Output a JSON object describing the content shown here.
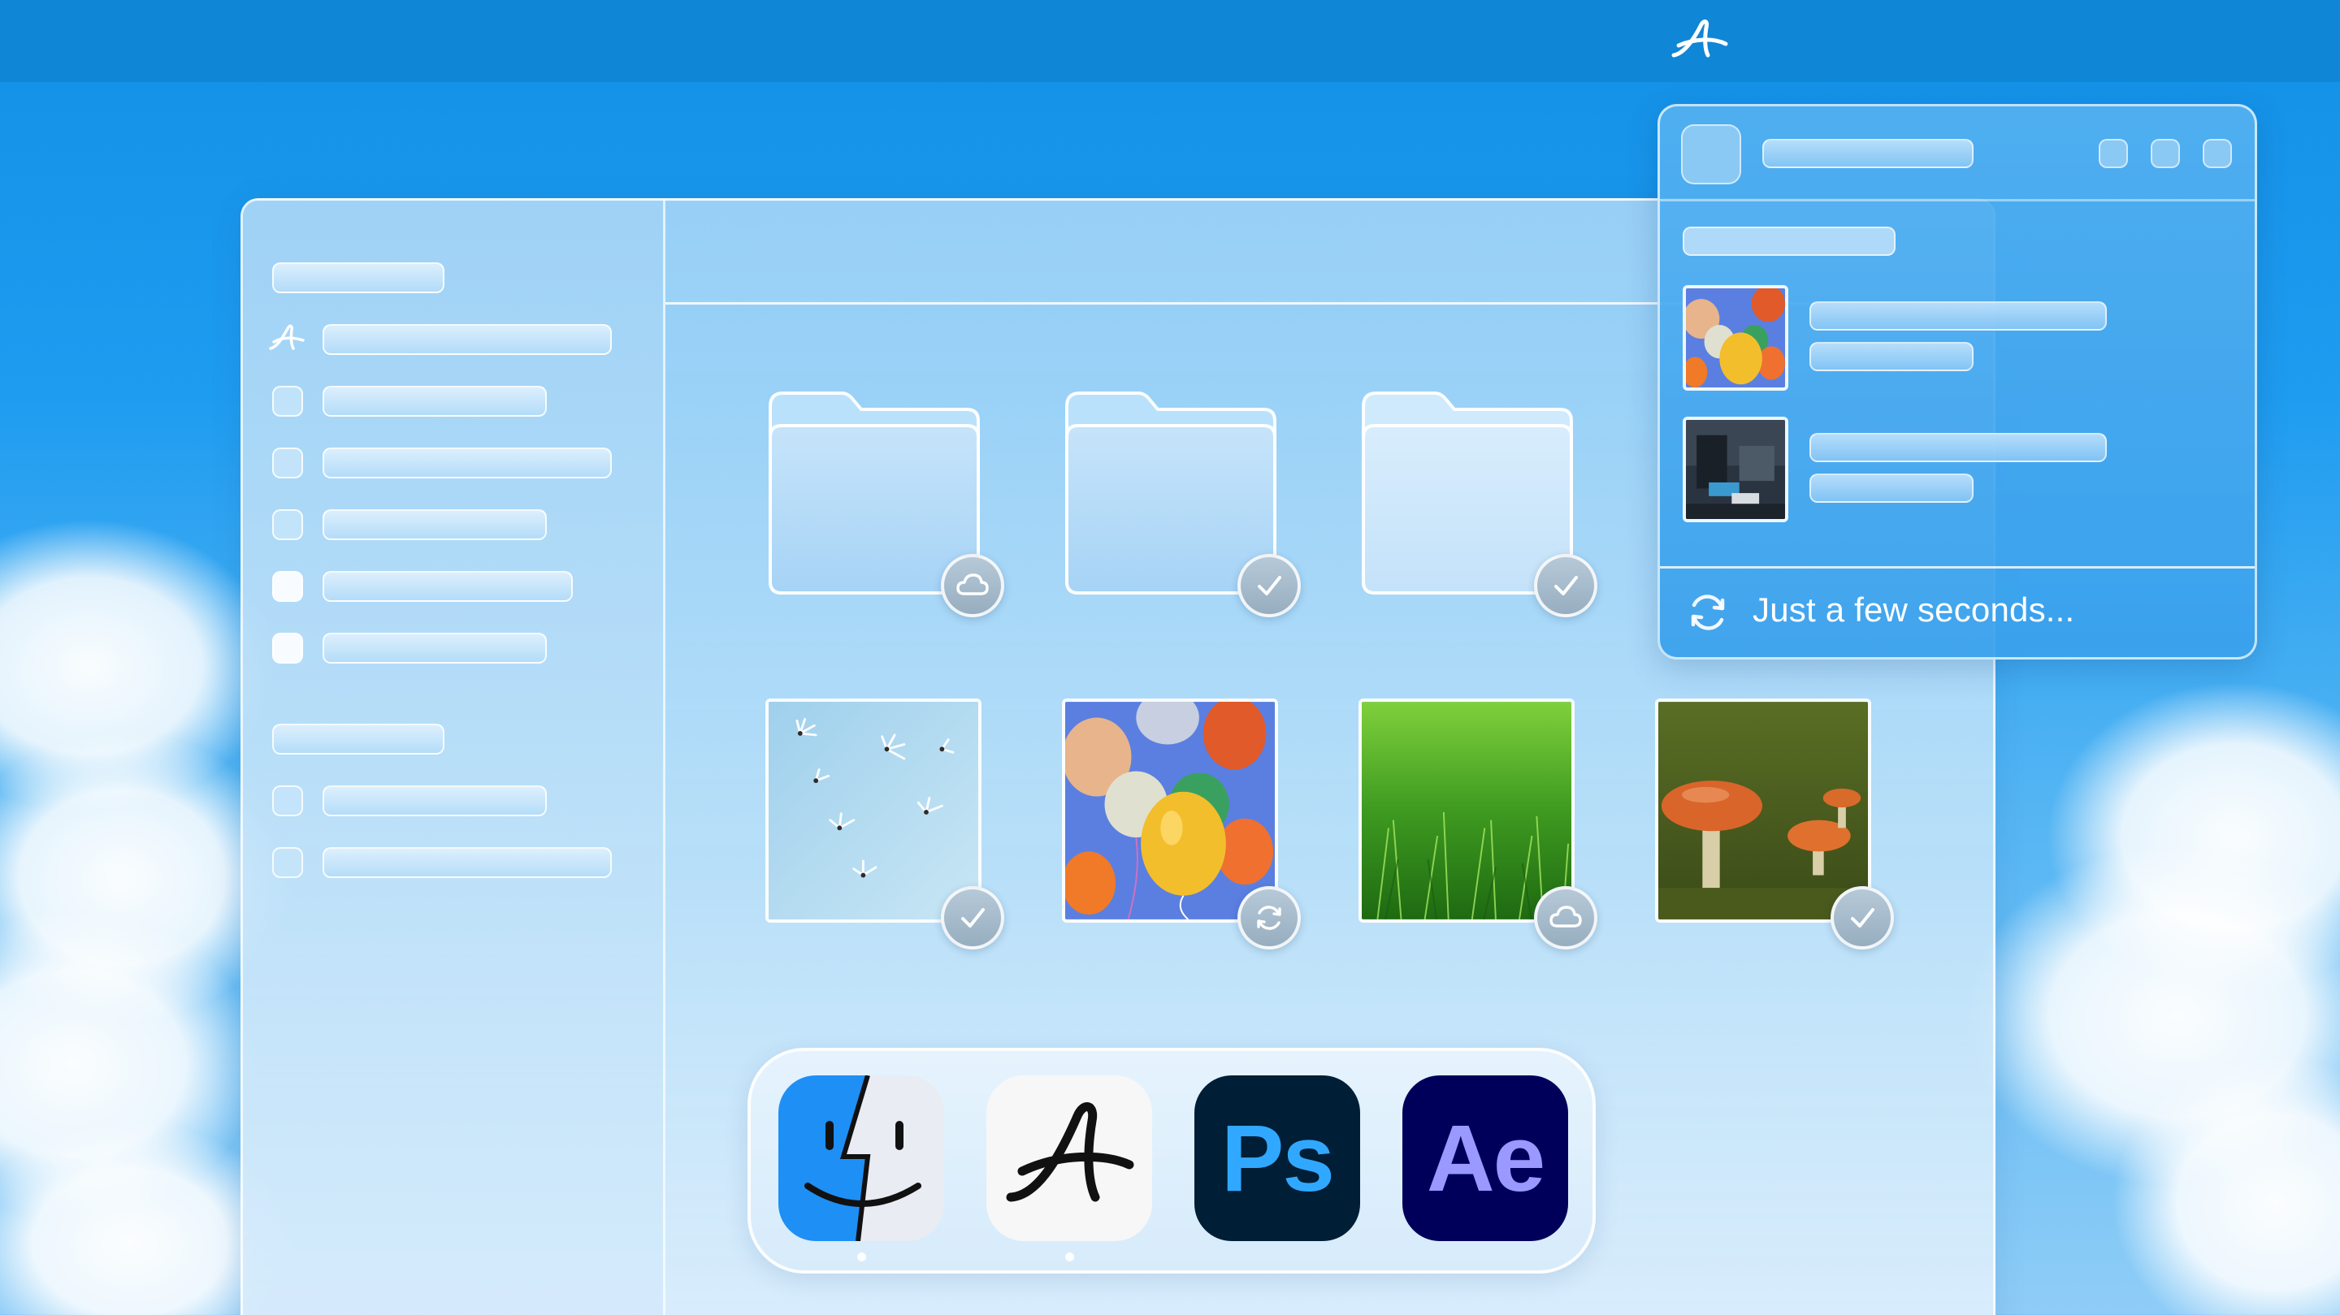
{
  "menubar": {
    "app_icon": "acrobat-signature-icon"
  },
  "sidebar": {
    "section1_items": [
      {
        "icon": "acrobat-signature-icon"
      },
      {
        "icon": "placeholder-square-icon"
      },
      {
        "icon": "placeholder-square-icon"
      },
      {
        "icon": "placeholder-square-icon"
      },
      {
        "icon": "placeholder-square-icon",
        "highlighted": true
      },
      {
        "icon": "placeholder-square-icon"
      }
    ],
    "section2_items": [
      {
        "icon": "placeholder-square-icon"
      },
      {
        "icon": "placeholder-square-icon"
      }
    ]
  },
  "folders": [
    {
      "status": "cloud-icon"
    },
    {
      "status": "checkmark-icon"
    },
    {
      "status": "checkmark-icon"
    }
  ],
  "files": [
    {
      "subject": "dandelion seeds",
      "status": "checkmark-icon"
    },
    {
      "subject": "balloons",
      "status": "sync-icon"
    },
    {
      "subject": "grass",
      "status": "cloud-icon"
    },
    {
      "subject": "mushrooms",
      "status": "checkmark-icon"
    }
  ],
  "dock": {
    "apps": [
      {
        "name": "finder-icon"
      },
      {
        "name": "acrobat-icon",
        "label": ""
      },
      {
        "name": "photoshop-icon",
        "label": "Ps"
      },
      {
        "name": "after-effects-icon",
        "label": "Ae"
      }
    ]
  },
  "sync_panel": {
    "recent_items": [
      {
        "subject": "balloons"
      },
      {
        "subject": "dark room scene"
      }
    ],
    "status_text": "Just a few seconds..."
  },
  "colors": {
    "menubar": "#0f86d6",
    "photoshop_bg": "#001e36",
    "photoshop_fg": "#31a8ff",
    "after_effects_bg": "#00005b",
    "after_effects_fg": "#9999ff"
  }
}
